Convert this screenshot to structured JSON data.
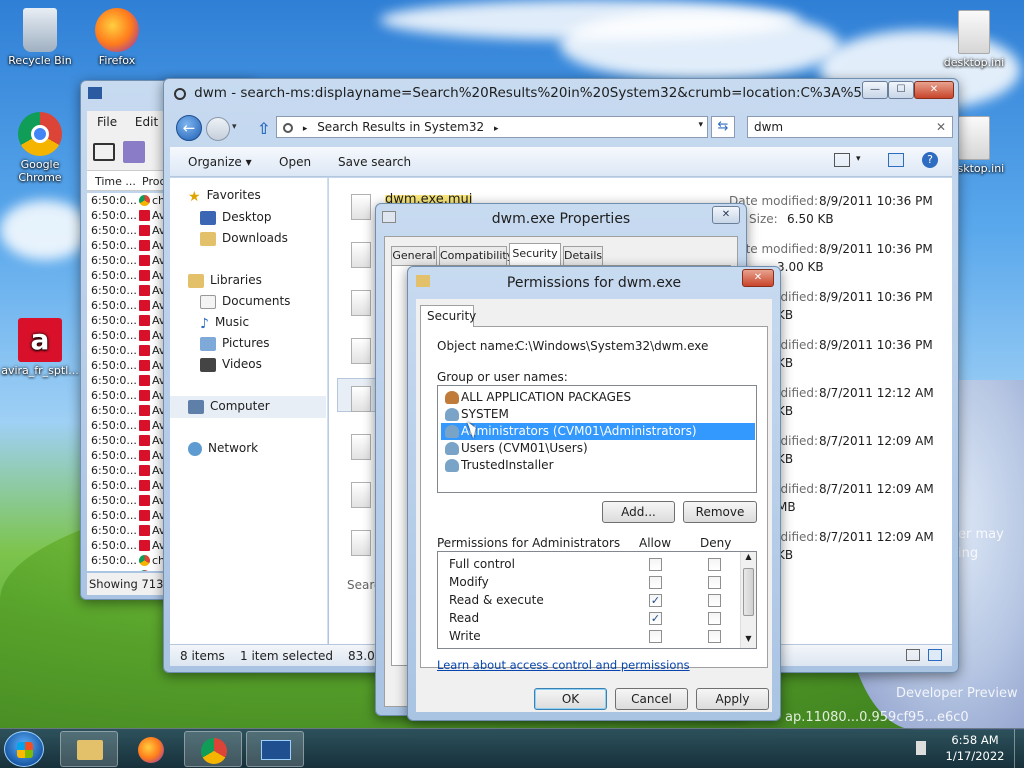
{
  "desktop": {
    "icons": [
      {
        "label": "Recycle Bin"
      },
      {
        "label": "Firefox"
      },
      {
        "label": "Google Chrome"
      },
      {
        "label": "avira_fr_sptl..."
      },
      {
        "label": "desktop.ini"
      },
      {
        "label": "desktop.ini"
      }
    ],
    "watermark_line1": "Developer Preview",
    "watermark_line2": "ap.11080...0.959cf95...e6c0",
    "watermark_side1": "er may",
    "watermark_side2": "ing"
  },
  "procmon": {
    "menu": [
      "File",
      "Edit"
    ],
    "columns": [
      "Time ...",
      "Proc"
    ],
    "rows": [
      {
        "time": "6:50:0...",
        "proc": "ch"
      },
      {
        "time": "6:50:0...",
        "proc": "Av"
      },
      {
        "time": "6:50:0...",
        "proc": "Av"
      },
      {
        "time": "6:50:0...",
        "proc": "Av"
      },
      {
        "time": "6:50:0...",
        "proc": "Av"
      },
      {
        "time": "6:50:0...",
        "proc": "Av"
      },
      {
        "time": "6:50:0...",
        "proc": "Av"
      },
      {
        "time": "6:50:0...",
        "proc": "Av"
      },
      {
        "time": "6:50:0...",
        "proc": "Av"
      },
      {
        "time": "6:50:0...",
        "proc": "Av"
      },
      {
        "time": "6:50:0...",
        "proc": "Av"
      },
      {
        "time": "6:50:0...",
        "proc": "Av"
      },
      {
        "time": "6:50:0...",
        "proc": "Av"
      },
      {
        "time": "6:50:0...",
        "proc": "Av"
      },
      {
        "time": "6:50:0...",
        "proc": "Av"
      },
      {
        "time": "6:50:0...",
        "proc": "Av"
      },
      {
        "time": "6:50:0...",
        "proc": "Av"
      },
      {
        "time": "6:50:0...",
        "proc": "Av"
      },
      {
        "time": "6:50:0...",
        "proc": "Av"
      },
      {
        "time": "6:50:0...",
        "proc": "Av"
      },
      {
        "time": "6:50:0...",
        "proc": "Av"
      },
      {
        "time": "6:50:0...",
        "proc": "Av"
      },
      {
        "time": "6:50:0...",
        "proc": "Av"
      },
      {
        "time": "6:50:0...",
        "proc": "Av"
      },
      {
        "time": "6:50:0...",
        "proc": "ch"
      },
      {
        "time": "6:50:0...",
        "proc": "ch"
      },
      {
        "time": "6:50:0...",
        "proc": "ch"
      }
    ],
    "status": "Showing 713,5..."
  },
  "explorer": {
    "title": "dwm - search-ms:displayname=Search%20Results%20in%20System32&crumb=location:C%3A%5C...",
    "address": "Search Results in System32",
    "search_value": "dwm",
    "toolbar": {
      "organize": "Organize ▾",
      "open": "Open",
      "save_search": "Save search"
    },
    "nav": {
      "favorites": "Favorites",
      "desktop": "Desktop",
      "downloads": "Downloads",
      "libraries": "Libraries",
      "documents": "Documents",
      "music": "Music",
      "pictures": "Pictures",
      "videos": "Videos",
      "computer": "Computer",
      "network": "Network"
    },
    "files": [
      {
        "name": "dwm.exe.mui",
        "modified_label": "Date modified:",
        "modified": "8/9/2011 10:36 PM",
        "size_label": "Size:",
        "size": "6.50 KB"
      },
      {
        "modified_label": "Date modified:",
        "modified": "8/9/2011 10:36 PM",
        "size": "3.00 KB"
      },
      {
        "modified_label": "Date modified:",
        "modified": "8/9/2011 10:36 PM",
        "size": "KB"
      },
      {
        "modified_label": "Date modified:",
        "modified": "8/9/2011 10:36 PM",
        "size": "KB"
      },
      {
        "modified_label": "Date modified:",
        "modified": "8/7/2011 12:12 AM",
        "size": "KB"
      },
      {
        "modified_label": "Date modified:",
        "modified": "8/7/2011 12:09 AM",
        "size": "KB"
      },
      {
        "modified_label": "Date modified:",
        "modified": "8/7/2011 12:09 AM",
        "size": "MB"
      },
      {
        "modified_label": "Date modified:",
        "modified": "8/7/2011 12:09 AM",
        "size": "KB"
      }
    ],
    "search_again": "Searc",
    "status": {
      "items": "8 items",
      "selected": "1 item selected",
      "size": "83.0 KB"
    }
  },
  "properties": {
    "title": "dwm.exe Properties",
    "tabs": [
      "General",
      "Compatibility",
      "Security",
      "Details"
    ]
  },
  "permissions": {
    "title": "Permissions for dwm.exe",
    "tab": "Security",
    "object_label": "Object name:",
    "object_value": "C:\\Windows\\System32\\dwm.exe",
    "group_label": "Group or user names:",
    "users": [
      "ALL APPLICATION PACKAGES",
      "SYSTEM",
      "Administrators (CVM01\\Administrators)",
      "Users (CVM01\\Users)",
      "TrustedInstaller"
    ],
    "add_button": "Add...",
    "remove_button": "Remove",
    "perm_header": "Permissions for Administrators",
    "allow_header": "Allow",
    "deny_header": "Deny",
    "perms": [
      {
        "name": "Full control",
        "allow": false,
        "deny": false
      },
      {
        "name": "Modify",
        "allow": false,
        "deny": false
      },
      {
        "name": "Read & execute",
        "allow": true,
        "deny": false
      },
      {
        "name": "Read",
        "allow": true,
        "deny": false
      },
      {
        "name": "Write",
        "allow": false,
        "deny": false
      }
    ],
    "learn_link": "Learn about access control and permissions",
    "ok": "OK",
    "cancel": "Cancel",
    "apply": "Apply"
  },
  "taskbar": {
    "time": "6:58 AM",
    "date": "1/17/2022"
  }
}
